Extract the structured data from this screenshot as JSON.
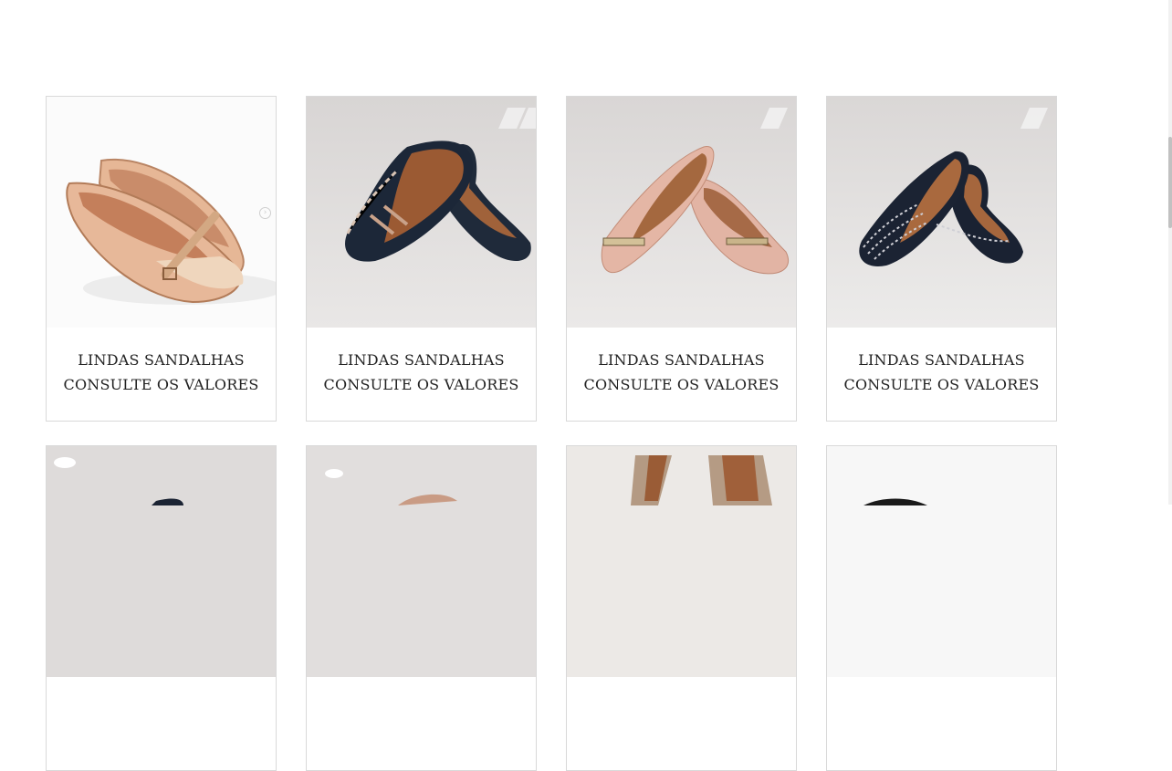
{
  "products": [
    {
      "line1": "LINDAS SANDALHAS",
      "line2": "CONSULTE OS VALORES",
      "image": "nude-patent-flats-with-buckle-strap"
    },
    {
      "line1": "LINDAS SANDALHAS",
      "line2": "CONSULTE OS VALORES",
      "image": "navy-flats-with-geometric-trim"
    },
    {
      "line1": "LINDAS SANDALHAS",
      "line2": "CONSULTE OS VALORES",
      "image": "pink-patent-flats-with-gold-bar"
    },
    {
      "line1": "LINDAS SANDALHAS",
      "line2": "CONSULTE OS VALORES",
      "image": "navy-flats-with-stitched-straps"
    }
  ],
  "carousel": {
    "next_icon": "chevron-right-icon"
  },
  "row2_images": [
    "navy-flat-partial",
    "nude-flat-partial",
    "woven-flats-partial",
    "black-flat-partial"
  ]
}
